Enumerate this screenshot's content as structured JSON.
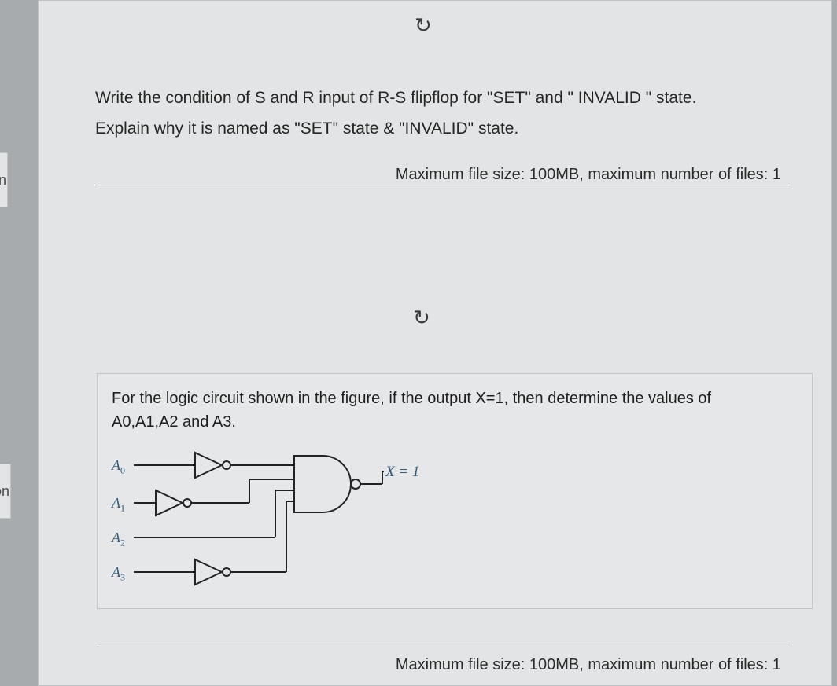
{
  "nav": {
    "stub1": "n",
    "stub2": "on"
  },
  "spinner_glyph": "↻",
  "question1": {
    "line1": "Write the condition of S and R input of R-S flipflop for \"SET\" and \" INVALID \" state.",
    "line2": "Explain why it is named as \"SET\" state & \"INVALID\" state."
  },
  "upload_note": "Maximum file size: 100MB, maximum number of files: 1",
  "question2": {
    "line1": "For the logic circuit shown in the figure, if the output X=1, then determine the values of",
    "line2": "A0,A1,A2 and A3."
  },
  "circuit": {
    "inputs": [
      "A₀",
      "A₁",
      "A₂",
      "A₃"
    ],
    "output_label": "X = 1",
    "gates": {
      "inverters_on": [
        "A0",
        "A1",
        "A3"
      ],
      "final_gate": "NAND-4"
    }
  }
}
